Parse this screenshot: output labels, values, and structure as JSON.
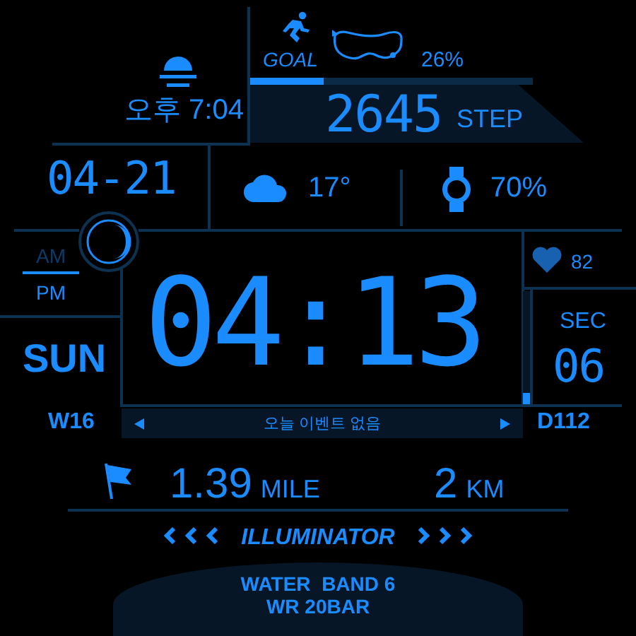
{
  "sunset": {
    "time": "오후 7:04"
  },
  "goal": {
    "label": "GOAL",
    "percent": "26%",
    "level": 0.26
  },
  "steps": {
    "count": "2645",
    "unit": "STEP"
  },
  "date": "04-21",
  "weather": {
    "temperature": "17°"
  },
  "watch_battery": {
    "percent": "70%"
  },
  "meridiem": [
    {
      "label": "AM",
      "selected": false
    },
    {
      "label": "PM",
      "selected": true
    }
  ],
  "time": "04:13",
  "heart_rate": "82",
  "seconds": {
    "label": "SEC",
    "value": "06",
    "level": 0.1
  },
  "day": "SUN",
  "week": "W16",
  "day_of_year": "D112",
  "event": {
    "text": "오늘 이벤트 없음"
  },
  "distance": [
    {
      "value": "1.39",
      "unit": "MILE"
    },
    {
      "value": "2",
      "unit": "KM"
    }
  ],
  "brand": "ILLUMINATOR",
  "footer": [
    "WATER  BAND 6",
    "WR 20BAR"
  ]
}
